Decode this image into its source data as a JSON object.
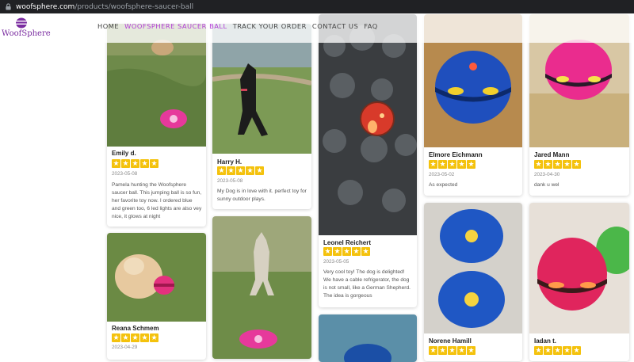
{
  "browser": {
    "url_host": "woofsphere.com",
    "url_path": "/products/woofsphere-saucer-ball"
  },
  "header": {
    "brand": "WoofSphere",
    "nav": [
      {
        "label": "HOME",
        "active": false
      },
      {
        "label": "WOOFSPHERE SAUCER BALL",
        "active": true
      },
      {
        "label": "TRACK YOUR ORDER",
        "active": false
      },
      {
        "label": "CONTACT US",
        "active": false
      },
      {
        "label": "FAQ",
        "active": false
      }
    ],
    "accent": "#b13bd6"
  },
  "reviews": [
    {
      "name": "Emily d.",
      "rating": 5,
      "date": "2023-05-08",
      "text": "Pamela hunting the Woofsphere saucer ball.  This jumping ball is so fun, her favorite toy now. I ordered blue and green too, 6 led lights are also vey nice, it glows at night"
    },
    {
      "name": "Harry H.",
      "rating": 5,
      "date": "2023-05-08",
      "text": "My Dog is in love with it. perfect toy for sunny outdoor plays."
    },
    {
      "name": "Leonel Reichert",
      "rating": 5,
      "date": "2023-05-05",
      "text": "Very cool toy! The dog is delighted! We have a cable refrigerator, the dog is not small, like a German Shepherd.  The idea is gorgeous"
    },
    {
      "name": "Elmore Eichmann",
      "rating": 5,
      "date": "2023-05-02",
      "text": "As expected"
    },
    {
      "name": "Jared Mann",
      "rating": 5,
      "date": "2023-04-30",
      "text": "dank u wel"
    },
    {
      "name": "Reana Schmem",
      "rating": 5,
      "date": "2023-04-29",
      "text": ""
    },
    {
      "name": "Norene Hamill",
      "rating": 5,
      "date": "",
      "text": ""
    },
    {
      "name": "Iadan t.",
      "rating": 5,
      "date": "",
      "text": ""
    }
  ],
  "star_color": "#f4c20d"
}
